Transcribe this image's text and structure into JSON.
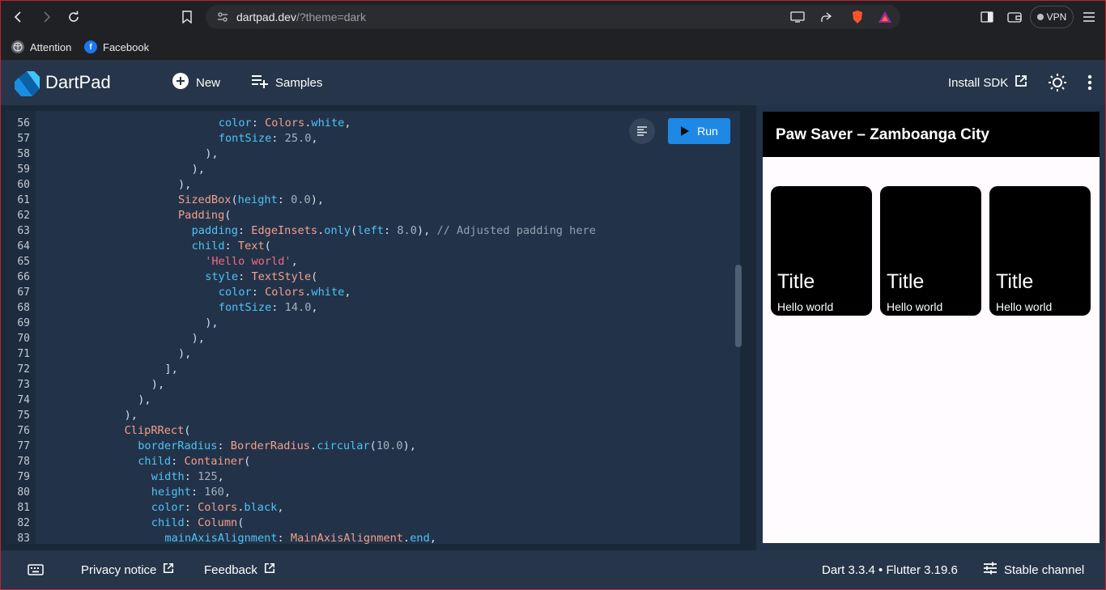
{
  "browser": {
    "url_host": "dartpad.dev",
    "url_path": "/?theme=dark",
    "vpn_label": "VPN",
    "bookmarks": [
      {
        "label": "Attention"
      },
      {
        "label": "Facebook"
      }
    ]
  },
  "header": {
    "app_title": "DartPad",
    "new_label": "New",
    "samples_label": "Samples",
    "install_sdk_label": "Install SDK"
  },
  "editor": {
    "run_label": "Run",
    "line_numbers": [
      "56",
      "57",
      "58",
      "59",
      "60",
      "61",
      "62",
      "63",
      "64",
      "65",
      "66",
      "67",
      "68",
      "69",
      "70",
      "71",
      "72",
      "73",
      "74",
      "75",
      "76",
      "77",
      "78",
      "79",
      "80",
      "81",
      "82",
      "83"
    ],
    "lines": [
      {
        "indent": "              ",
        "tokens": [
          [
            "prop",
            "color"
          ],
          [
            "punc",
            ": "
          ],
          [
            "cls",
            "Colors"
          ],
          [
            "punc",
            "."
          ],
          [
            "prop",
            "white"
          ],
          [
            "punc",
            ","
          ]
        ]
      },
      {
        "indent": "              ",
        "tokens": [
          [
            "prop",
            "fontSize"
          ],
          [
            "punc",
            ": "
          ],
          [
            "num",
            "25.0"
          ],
          [
            "punc",
            ","
          ]
        ]
      },
      {
        "indent": "            ",
        "tokens": [
          [
            "punc",
            "),"
          ]
        ]
      },
      {
        "indent": "          ",
        "tokens": [
          [
            "punc",
            "),"
          ]
        ]
      },
      {
        "indent": "        ",
        "tokens": [
          [
            "punc",
            "),"
          ]
        ]
      },
      {
        "indent": "        ",
        "tokens": [
          [
            "cls",
            "SizedBox"
          ],
          [
            "punc",
            "("
          ],
          [
            "prop",
            "height"
          ],
          [
            "punc",
            ": "
          ],
          [
            "num",
            "0.0"
          ],
          [
            "punc",
            "),"
          ]
        ]
      },
      {
        "indent": "        ",
        "tokens": [
          [
            "cls",
            "Padding"
          ],
          [
            "punc",
            "("
          ]
        ]
      },
      {
        "indent": "          ",
        "tokens": [
          [
            "prop",
            "padding"
          ],
          [
            "punc",
            ": "
          ],
          [
            "cls",
            "EdgeInsets"
          ],
          [
            "punc",
            "."
          ],
          [
            "prop",
            "only"
          ],
          [
            "punc",
            "("
          ],
          [
            "prop",
            "left"
          ],
          [
            "punc",
            ": "
          ],
          [
            "num",
            "8.0"
          ],
          [
            "punc",
            "), "
          ],
          [
            "cmt",
            "// Adjusted padding here"
          ]
        ]
      },
      {
        "indent": "          ",
        "tokens": [
          [
            "prop",
            "child"
          ],
          [
            "punc",
            ": "
          ],
          [
            "cls",
            "Text"
          ],
          [
            "punc",
            "("
          ]
        ]
      },
      {
        "indent": "            ",
        "tokens": [
          [
            "str",
            "'Hello world'"
          ],
          [
            "punc",
            ","
          ]
        ]
      },
      {
        "indent": "            ",
        "tokens": [
          [
            "prop",
            "style"
          ],
          [
            "punc",
            ": "
          ],
          [
            "cls",
            "TextStyle"
          ],
          [
            "punc",
            "("
          ]
        ]
      },
      {
        "indent": "              ",
        "tokens": [
          [
            "prop",
            "color"
          ],
          [
            "punc",
            ": "
          ],
          [
            "cls",
            "Colors"
          ],
          [
            "punc",
            "."
          ],
          [
            "prop",
            "white"
          ],
          [
            "punc",
            ","
          ]
        ]
      },
      {
        "indent": "              ",
        "tokens": [
          [
            "prop",
            "fontSize"
          ],
          [
            "punc",
            ": "
          ],
          [
            "num",
            "14.0"
          ],
          [
            "punc",
            ","
          ]
        ]
      },
      {
        "indent": "            ",
        "tokens": [
          [
            "punc",
            "),"
          ]
        ]
      },
      {
        "indent": "          ",
        "tokens": [
          [
            "punc",
            "),"
          ]
        ]
      },
      {
        "indent": "        ",
        "tokens": [
          [
            "punc",
            "),"
          ]
        ]
      },
      {
        "indent": "      ",
        "tokens": [
          [
            "punc",
            "],"
          ]
        ]
      },
      {
        "indent": "    ",
        "tokens": [
          [
            "punc",
            "),"
          ]
        ]
      },
      {
        "indent": "  ",
        "tokens": [
          [
            "punc",
            "),"
          ]
        ]
      },
      {
        "indent": "",
        "tokens": [
          [
            "punc",
            "),"
          ]
        ]
      },
      {
        "indent": "",
        "tokens": [
          [
            "cls",
            "ClipRRect"
          ],
          [
            "punc",
            "("
          ]
        ]
      },
      {
        "indent": "  ",
        "tokens": [
          [
            "prop",
            "borderRadius"
          ],
          [
            "punc",
            ": "
          ],
          [
            "cls",
            "BorderRadius"
          ],
          [
            "punc",
            "."
          ],
          [
            "prop",
            "circular"
          ],
          [
            "punc",
            "("
          ],
          [
            "num",
            "10.0"
          ],
          [
            "punc",
            "),"
          ]
        ]
      },
      {
        "indent": "  ",
        "tokens": [
          [
            "prop",
            "child"
          ],
          [
            "punc",
            ": "
          ],
          [
            "cls",
            "Container"
          ],
          [
            "punc",
            "("
          ]
        ]
      },
      {
        "indent": "    ",
        "tokens": [
          [
            "prop",
            "width"
          ],
          [
            "punc",
            ": "
          ],
          [
            "num",
            "125"
          ],
          [
            "punc",
            ","
          ]
        ]
      },
      {
        "indent": "    ",
        "tokens": [
          [
            "prop",
            "height"
          ],
          [
            "punc",
            ": "
          ],
          [
            "num",
            "160"
          ],
          [
            "punc",
            ","
          ]
        ]
      },
      {
        "indent": "    ",
        "tokens": [
          [
            "prop",
            "color"
          ],
          [
            "punc",
            ": "
          ],
          [
            "cls",
            "Colors"
          ],
          [
            "punc",
            "."
          ],
          [
            "prop",
            "black"
          ],
          [
            "punc",
            ","
          ]
        ]
      },
      {
        "indent": "    ",
        "tokens": [
          [
            "prop",
            "child"
          ],
          [
            "punc",
            ": "
          ],
          [
            "cls",
            "Column"
          ],
          [
            "punc",
            "("
          ]
        ]
      },
      {
        "indent": "      ",
        "tokens": [
          [
            "prop",
            "mainAxisAlignment"
          ],
          [
            "punc",
            ": "
          ],
          [
            "cls",
            "MainAxisAlignment"
          ],
          [
            "punc",
            "."
          ],
          [
            "prop",
            "end"
          ],
          [
            "punc",
            ","
          ]
        ]
      }
    ]
  },
  "preview": {
    "appbar_title": "Paw Saver – Zamboanga City",
    "cards": [
      {
        "title": "Title",
        "subtitle": "Hello world"
      },
      {
        "title": "Title",
        "subtitle": "Hello world"
      },
      {
        "title": "Title",
        "subtitle": "Hello world"
      }
    ]
  },
  "footer": {
    "privacy_label": "Privacy notice",
    "feedback_label": "Feedback",
    "version_label": "Dart 3.3.4 • Flutter 3.19.6",
    "channel_label": "Stable channel"
  },
  "colors": {
    "accent": "#1e88e5",
    "header_bg": "#263549",
    "editor_bg": "#223349"
  }
}
